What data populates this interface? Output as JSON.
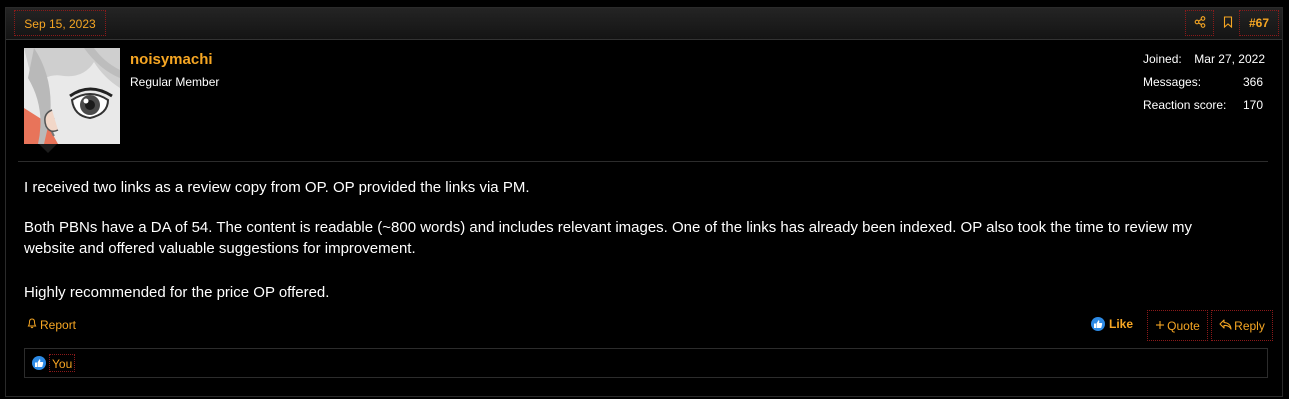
{
  "post": {
    "date": "Sep 15, 2023",
    "number": "#67",
    "author": {
      "name": "noisymachi",
      "title": "Regular Member"
    },
    "stats": [
      {
        "label": "Joined:",
        "value": "Mar 27, 2022"
      },
      {
        "label": "Messages:",
        "value": "366"
      },
      {
        "label": "Reaction score:",
        "value": "170"
      }
    ],
    "content": [
      "I received two links as a review copy from OP. OP provided the links via PM.",
      "Both PBNs have a DA of 54. The content is readable (~800 words) and includes relevant images. One of the links has already been indexed. OP also took the time to review my website and offered valuable suggestions for improvement.",
      "Highly recommended for the price OP offered."
    ],
    "actions": {
      "report": "Report",
      "like": "Like",
      "quote": "Quote",
      "reply": "Reply"
    },
    "reactions": {
      "user": "You"
    }
  },
  "icons": [
    "share-icon",
    "bookmark-icon",
    "bell-icon",
    "like-icon",
    "plus-icon",
    "reply-icon"
  ],
  "colors": {
    "accent": "#f6a623",
    "background": "#000000",
    "like_blue": "#2d8ae5",
    "dotted_border": "#8b1a1a"
  }
}
